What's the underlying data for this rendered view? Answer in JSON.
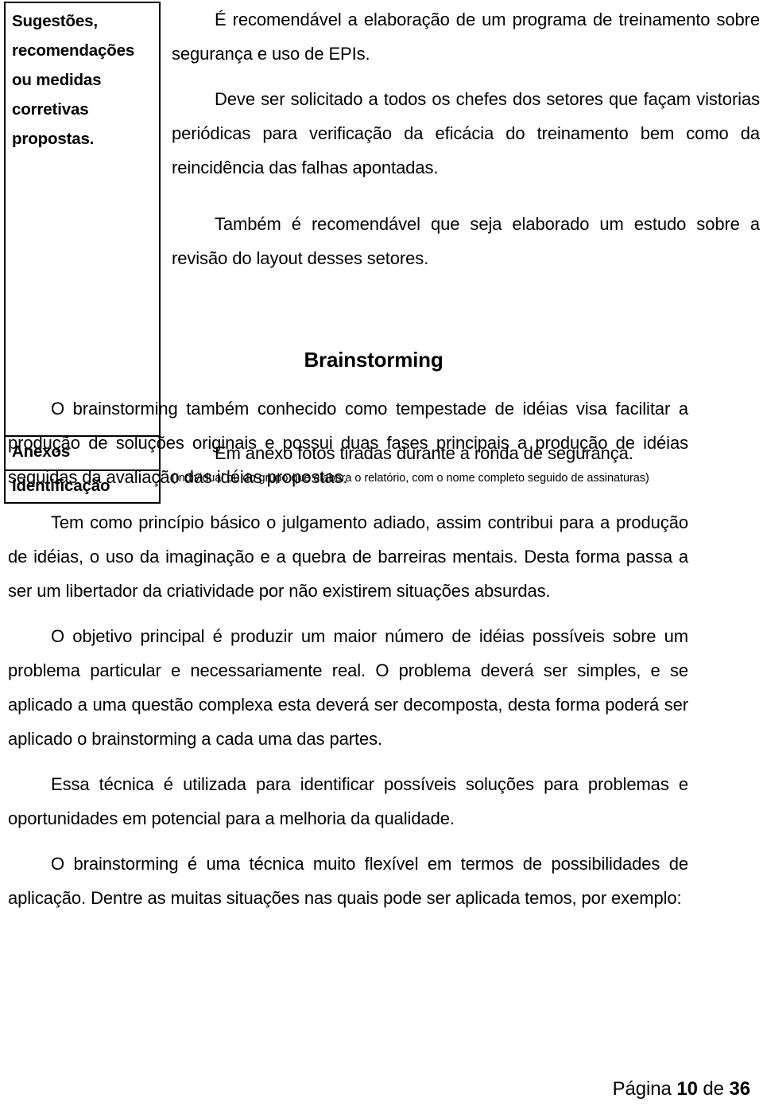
{
  "document": {
    "table": {
      "rows": [
        {
          "label": "Sugestões, recomendações ou medidas corretivas propostas.",
          "label_lines": [
            "Sugestões,",
            "recomendações",
            "ou medidas",
            "corretivas",
            "propostas."
          ],
          "paragraphs": [
            "É recomendável a elaboração de um programa de treinamento sobre segurança e uso de EPIs.",
            "Deve ser solicitado a todos os chefes dos setores que façam vistorias periódicas para verificação da eficácia do treinamento bem como da reincidência das falhas apontadas.",
            "Também é recomendável que seja elaborado um estudo sobre a revisão do layout desses setores."
          ]
        },
        {
          "label": "Anexos",
          "paragraphs": [
            "Em anexo fotos tiradas durante a ronda de segurança."
          ]
        },
        {
          "label": "Identificação",
          "note": "(Individual ou do grupo que elabora o relatório, com o nome completo seguido de assinaturas)"
        }
      ]
    },
    "section": {
      "title": "Brainstorming",
      "paragraphs": [
        "O brainstorming também conhecido como tempestade de idéias visa facilitar a produção de soluções originais e possui duas fases principais a produção de idéias seguidas da avaliação das idéias propostas.",
        "Tem como princípio básico o julgamento adiado, assim contribui para a produção de idéias, o uso da imaginação e a quebra de barreiras mentais. Desta forma passa a ser um libertador da criatividade por não existirem situações absurdas.",
        "O objetivo principal é produzir um maior número de idéias possíveis sobre um problema particular e necessariamente real. O problema deverá ser simples, e se aplicado a uma questão complexa esta deverá ser decomposta, desta forma poderá ser aplicado o brainstorming a cada uma das partes.",
        "Essa técnica é utilizada para identificar possíveis soluções para problemas e oportunidades em potencial para a melhoria da qualidade.",
        "O brainstorming é uma técnica muito flexível em termos de possibilidades de aplicação. Dentre as muitas situações nas quais pode ser aplicada temos, por exemplo:"
      ]
    },
    "footer": {
      "prefix": "Página",
      "current_page": "10",
      "middle": "de",
      "total_pages": "36"
    },
    "colors": {
      "text": "#000000",
      "background": "#ffffff",
      "table_border": "#000000"
    }
  }
}
